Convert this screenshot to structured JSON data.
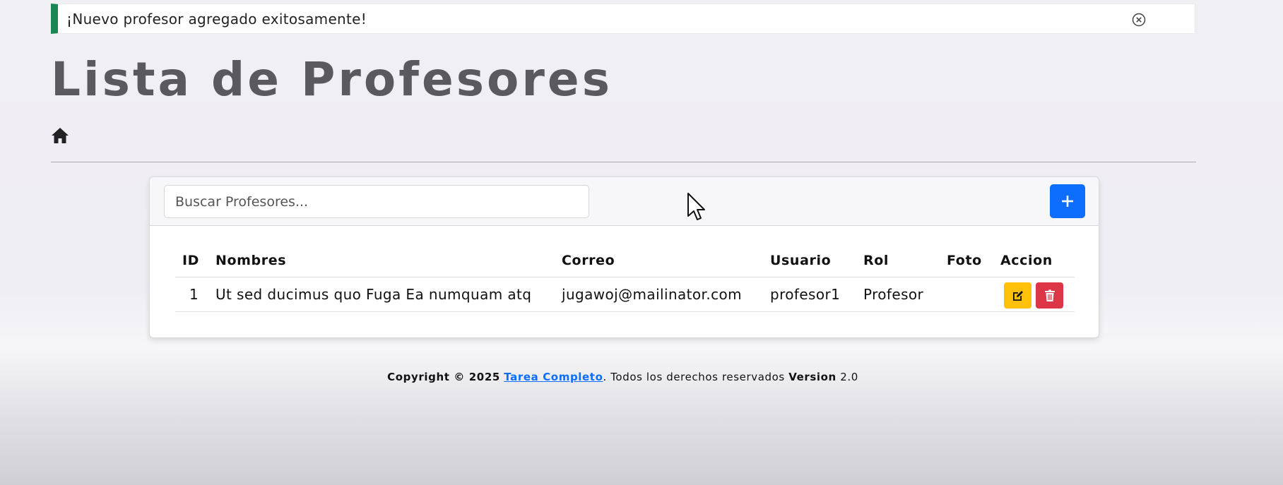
{
  "alert": {
    "message": "¡Nuevo profesor agregado exitosamente!",
    "close_icon": "close-circle-icon",
    "accent_color": "#198754"
  },
  "page": {
    "title": "Lista de Profesores",
    "home_icon": "home-icon"
  },
  "search": {
    "placeholder": "Buscar Profesores...",
    "value": ""
  },
  "toolbar": {
    "add_icon": "plus-icon",
    "add_color": "#0d6efd"
  },
  "table": {
    "headers": {
      "id": "ID",
      "nombres": "Nombres",
      "correo": "Correo",
      "usuario": "Usuario",
      "rol": "Rol",
      "foto": "Foto",
      "accion": "Accion"
    },
    "rows": [
      {
        "id": "1",
        "nombres": "Ut sed ducimus quo Fuga Ea numquam atq",
        "correo": "jugawoj@mailinator.com",
        "usuario": "profesor1",
        "rol": "Profesor",
        "foto": ""
      }
    ],
    "edit_icon": "edit-icon",
    "delete_icon": "trash-icon",
    "edit_color": "#ffc107",
    "delete_color": "#dc3545"
  },
  "footer": {
    "copyright": "Copyright © 2025",
    "link_text": "Tarea Completo",
    "rights": ". Todos los derechos reservados",
    "version_label": "Version",
    "version_value": "2.0"
  }
}
